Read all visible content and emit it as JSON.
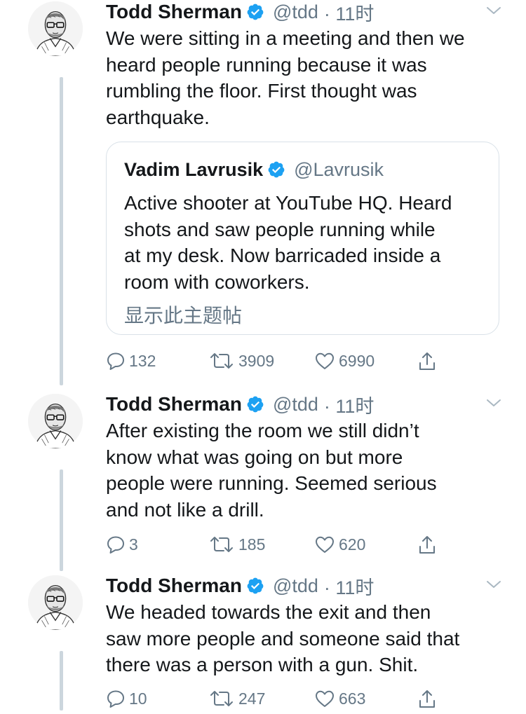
{
  "tweets": [
    {
      "author": "Todd Sherman",
      "handle": "@tdd",
      "time": "· 11时",
      "text_lines": [
        "We were sitting in a meeting and then we",
        "heard people running because it was",
        "rumbling the floor. First thought was",
        "earthquake."
      ],
      "quote": {
        "author": "Vadim Lavrusik",
        "handle": "@Lavrusik",
        "text_lines": [
          "Active shooter at YouTube HQ. Heard",
          "shots and saw people running while",
          "at my desk. Now barricaded inside a",
          "room with coworkers."
        ],
        "show_thread": "显示此主题帖"
      },
      "replies": "132",
      "retweets": "3909",
      "likes": "6990"
    },
    {
      "author": "Todd Sherman",
      "handle": "@tdd",
      "time": "· 11时",
      "text_lines": [
        "After existing the room we still didn’t",
        "know what was going on but more",
        "people were running. Seemed serious",
        "and not like a drill."
      ],
      "replies": "3",
      "retweets": "185",
      "likes": "620"
    },
    {
      "author": "Todd Sherman",
      "handle": "@tdd",
      "time": "· 11时",
      "text_lines": [
        "We headed towards the exit and then",
        "saw more people and someone said that",
        "there was a person with a gun. Shit."
      ],
      "replies": "10",
      "retweets": "247",
      "likes": "663"
    }
  ],
  "colors": {
    "verified": "#1da1f2",
    "secondary_text": "#657786",
    "thread_line": "#ccd6dd"
  },
  "icons": [
    "avatar-sketch",
    "verified-badge-icon",
    "chevron-down-icon",
    "reply-icon",
    "retweet-icon",
    "like-icon",
    "share-icon"
  ]
}
